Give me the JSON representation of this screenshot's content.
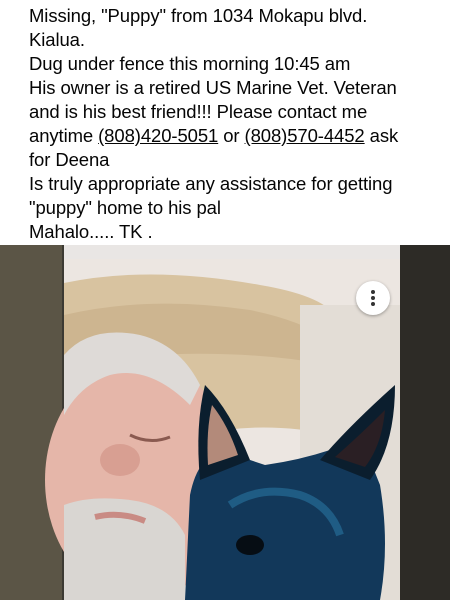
{
  "post": {
    "line1": "Missing,  \"Puppy\" from 1034 Mokapu blvd.",
    "line2": "Kialua.",
    "line3": "Dug under fence this morning 10:45 am",
    "line4": "His owner is a retired US Marine Vet. Veteran",
    "line5": "and is his best friend!!! Please contact me",
    "line6_pre": "anytime ",
    "phone1": "(808)420-5051",
    "line6_mid": " or ",
    "phone2": "(808)570-4452",
    "line6_post": " ask",
    "line7": "for Deena",
    "line8": "Is truly appropriate any assistance for getting",
    "line9": "\"puppy\" home to his pal",
    "line10": "Mahalo..... TK ."
  },
  "photo": {
    "subject": "man-with-dog-selfie",
    "menu_icon": "more-vertical-icon",
    "colors": {
      "dog": "#12385a",
      "pillow": "#d8c3a0",
      "skin": "#e8b9ad",
      "border": "#3c3a33"
    }
  }
}
